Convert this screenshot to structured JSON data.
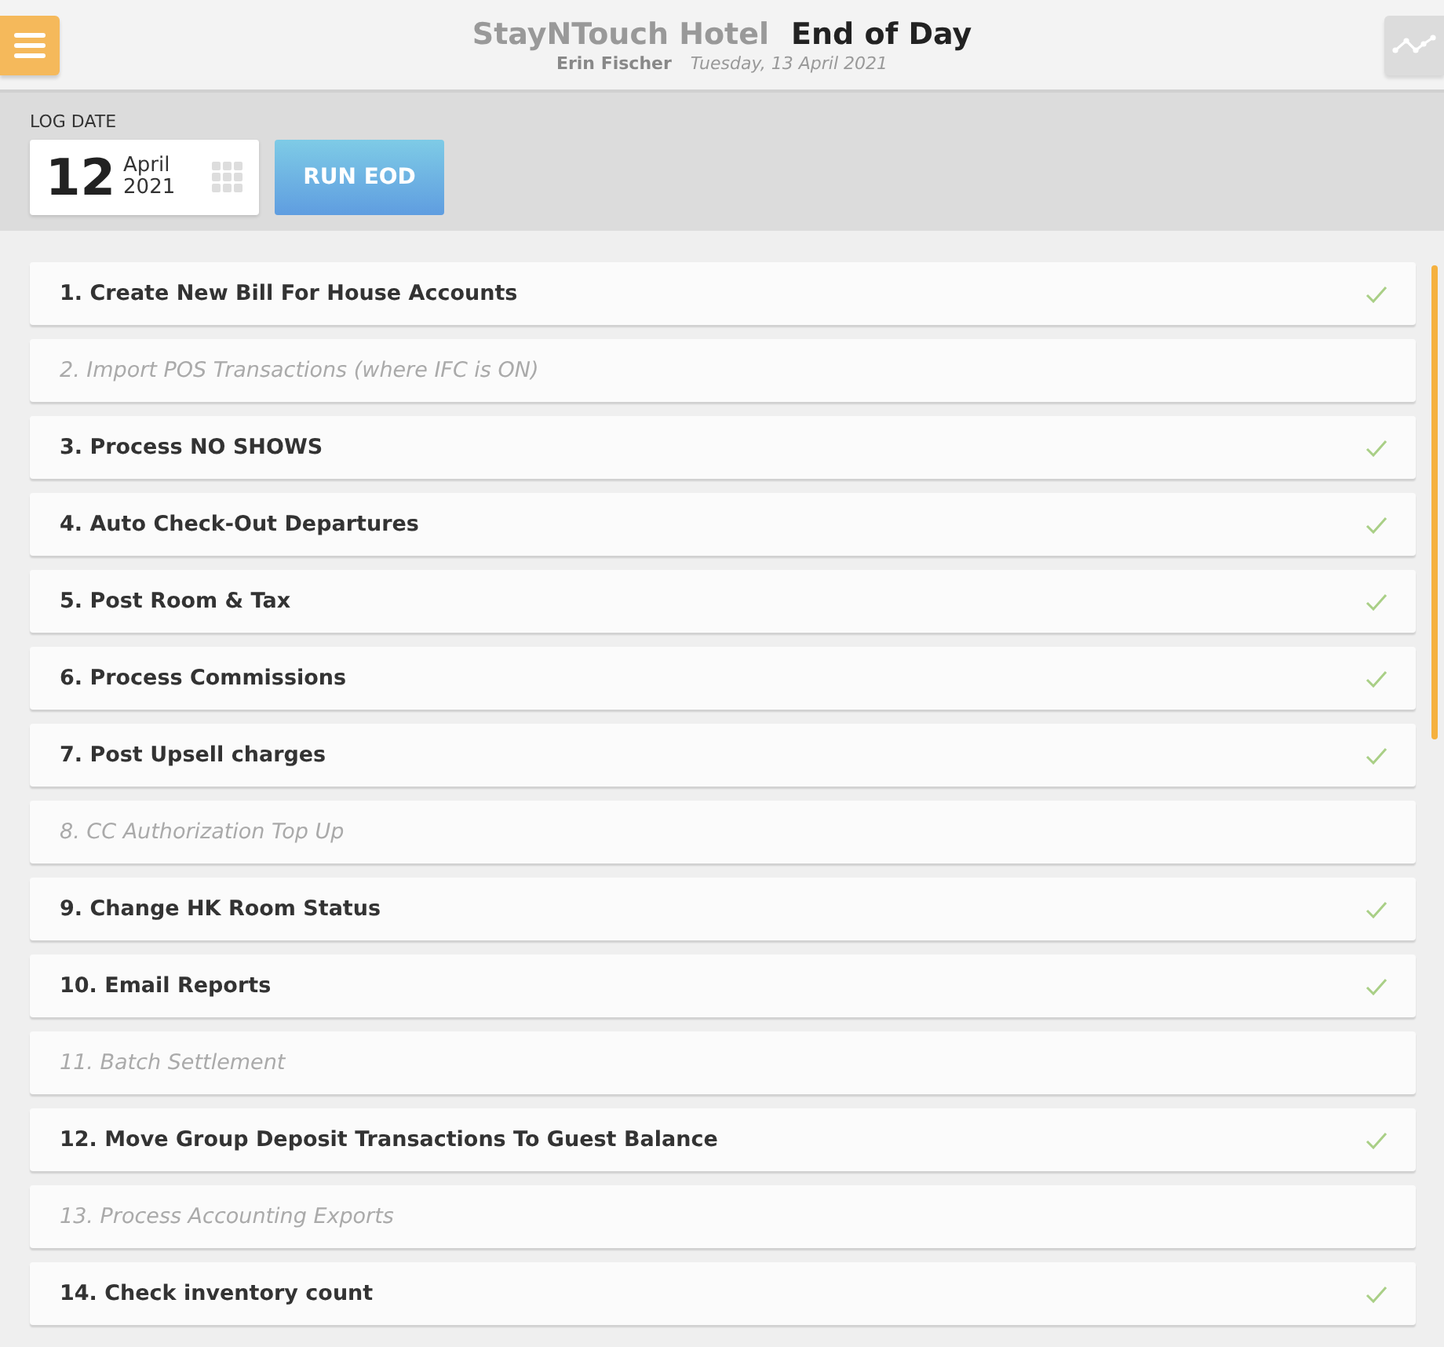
{
  "header": {
    "hotel": "StayNTouch Hotel",
    "title": "End of Day",
    "user": "Erin Fischer",
    "date": "Tuesday, 13 April 2021"
  },
  "log_date": {
    "label": "LOG DATE",
    "day": "12",
    "month": "April",
    "year": "2021"
  },
  "run_button": "RUN EOD",
  "steps": [
    {
      "label": "1. Create New Bill For House Accounts",
      "disabled": false,
      "checked": true
    },
    {
      "label": "2. Import POS Transactions (where IFC is ON)",
      "disabled": true,
      "checked": false
    },
    {
      "label": "3. Process NO SHOWS",
      "disabled": false,
      "checked": true
    },
    {
      "label": "4. Auto Check-Out Departures",
      "disabled": false,
      "checked": true
    },
    {
      "label": "5. Post Room & Tax",
      "disabled": false,
      "checked": true
    },
    {
      "label": "6. Process Commissions",
      "disabled": false,
      "checked": true
    },
    {
      "label": "7. Post Upsell charges",
      "disabled": false,
      "checked": true
    },
    {
      "label": "8. CC Authorization Top Up",
      "disabled": true,
      "checked": false
    },
    {
      "label": "9. Change HK Room Status",
      "disabled": false,
      "checked": true
    },
    {
      "label": "10. Email Reports",
      "disabled": false,
      "checked": true
    },
    {
      "label": "11. Batch Settlement",
      "disabled": true,
      "checked": false
    },
    {
      "label": "12. Move Group Deposit Transactions To Guest Balance",
      "disabled": false,
      "checked": true
    },
    {
      "label": "13. Process Accounting Exports",
      "disabled": true,
      "checked": false
    },
    {
      "label": "14. Check inventory count",
      "disabled": false,
      "checked": true
    }
  ]
}
